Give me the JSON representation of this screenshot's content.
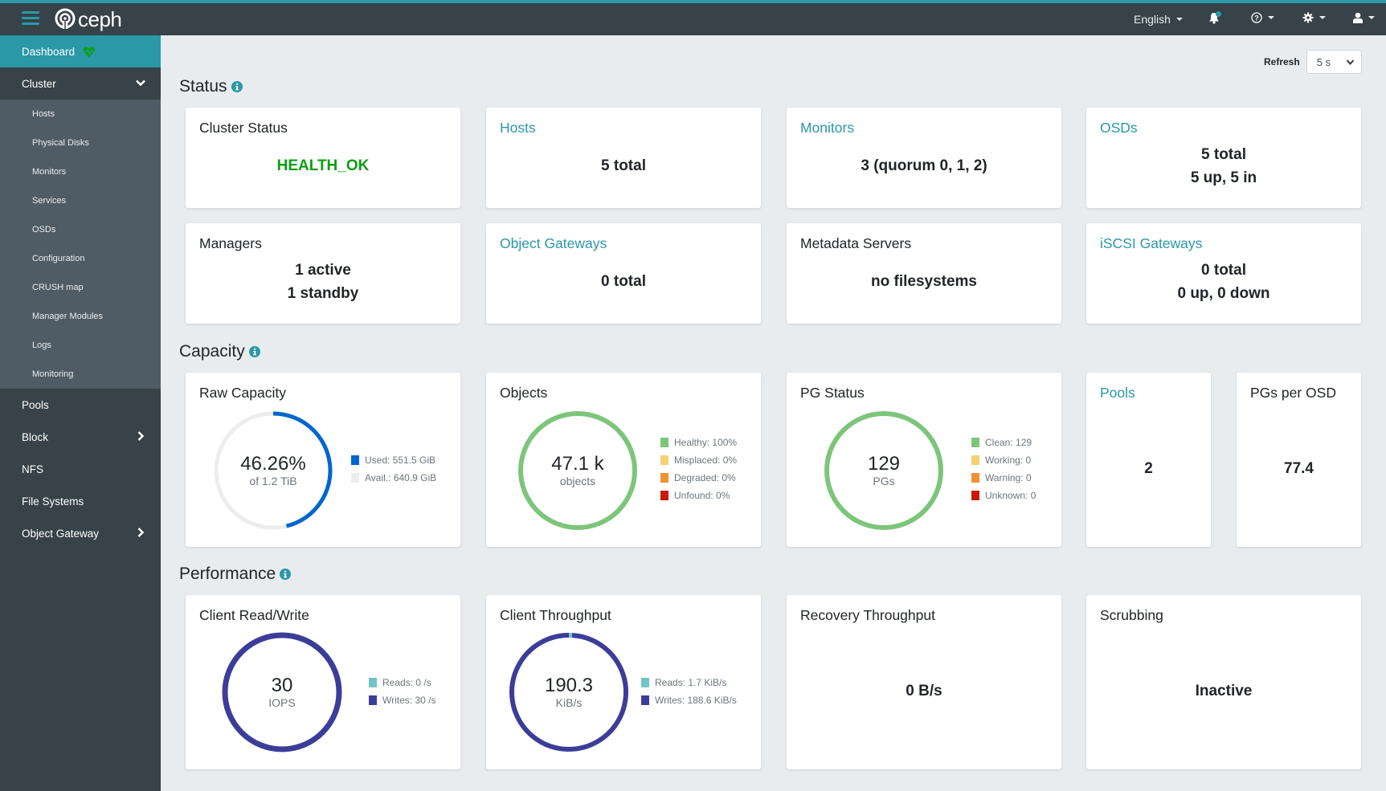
{
  "navbar": {
    "brand": "ceph",
    "language": "English",
    "icons": [
      "menu-icon",
      "ceph-logo-icon",
      "bell-icon",
      "help-icon",
      "gear-icon",
      "user-icon"
    ]
  },
  "sidebar": {
    "dashboard": "Dashboard",
    "cluster": "Cluster",
    "cluster_items": [
      "Hosts",
      "Physical Disks",
      "Monitors",
      "Services",
      "OSDs",
      "Configuration",
      "CRUSH map",
      "Manager Modules",
      "Logs",
      "Monitoring"
    ],
    "pools": "Pools",
    "block": "Block",
    "nfs": "NFS",
    "file_systems": "File Systems",
    "object_gateway": "Object Gateway"
  },
  "refresh": {
    "label": "Refresh",
    "value": "5 s"
  },
  "sections": {
    "status": "Status",
    "capacity": "Capacity",
    "performance": "Performance"
  },
  "status": {
    "cluster_status": {
      "title": "Cluster Status",
      "value": "HEALTH_OK"
    },
    "hosts": {
      "title": "Hosts",
      "value": "5 total"
    },
    "monitors": {
      "title": "Monitors",
      "value": "3 (quorum 0, 1, 2)"
    },
    "osds": {
      "title": "OSDs",
      "line1": "5 total",
      "line2": "5 up, 5 in"
    },
    "managers": {
      "title": "Managers",
      "line1": "1 active",
      "line2": "1 standby"
    },
    "object_gateways": {
      "title": "Object Gateways",
      "value": "0 total"
    },
    "metadata_servers": {
      "title": "Metadata Servers",
      "value": "no filesystems"
    },
    "iscsi_gateways": {
      "title": "iSCSI Gateways",
      "line1": "0 total",
      "line2": "0 up, 0 down"
    }
  },
  "capacity": {
    "raw": {
      "title": "Raw Capacity",
      "center_value": "46.26%",
      "center_sub": "of 1.2 TiB",
      "used_fraction": 0.4626,
      "legend": [
        {
          "label": "Used: 551.5 GiB",
          "color": "#0066cc"
        },
        {
          "label": "Avail.: 640.9 GiB",
          "color": "#ededed"
        }
      ]
    },
    "objects": {
      "title": "Objects",
      "center_value": "47.1 k",
      "center_sub": "objects",
      "segments": [
        100,
        0,
        0,
        0
      ],
      "legend": [
        {
          "label": "Healthy: 100%",
          "color": "#7dc57a"
        },
        {
          "label": "Misplaced: 0%",
          "color": "#f6d173"
        },
        {
          "label": "Degraded: 0%",
          "color": "#ef9234"
        },
        {
          "label": "Unfound: 0%",
          "color": "#c9190b"
        }
      ]
    },
    "pg_status": {
      "title": "PG Status",
      "center_value": "129",
      "center_sub": "PGs",
      "segments": [
        129,
        0,
        0,
        0
      ],
      "legend": [
        {
          "label": "Clean: 129",
          "color": "#7dc57a"
        },
        {
          "label": "Working: 0",
          "color": "#f6d173"
        },
        {
          "label": "Warning: 0",
          "color": "#ef9234"
        },
        {
          "label": "Unknown: 0",
          "color": "#c9190b"
        }
      ]
    },
    "pools": {
      "title": "Pools",
      "value": "2"
    },
    "pgs_per_osd": {
      "title": "PGs per OSD",
      "value": "77.4"
    }
  },
  "performance": {
    "client_rw": {
      "title": "Client Read/Write",
      "center_value": "30",
      "center_sub": "IOPS",
      "segments": [
        0,
        30
      ],
      "legend": [
        {
          "label": "Reads: 0 /s",
          "color": "#73c5c5"
        },
        {
          "label": "Writes: 30 /s",
          "color": "#3c3d99"
        }
      ]
    },
    "client_throughput": {
      "title": "Client Throughput",
      "center_value": "190.3",
      "center_sub": "KiB/s",
      "segments": [
        1.7,
        188.6
      ],
      "legend": [
        {
          "label": "Reads: 1.7 KiB/s",
          "color": "#73c5c5"
        },
        {
          "label": "Writes: 188.6 KiB/s",
          "color": "#3c3d99"
        }
      ]
    },
    "recovery_throughput": {
      "title": "Recovery Throughput",
      "value": "0 B/s"
    },
    "scrubbing": {
      "title": "Scrubbing",
      "value": "Inactive"
    }
  }
}
